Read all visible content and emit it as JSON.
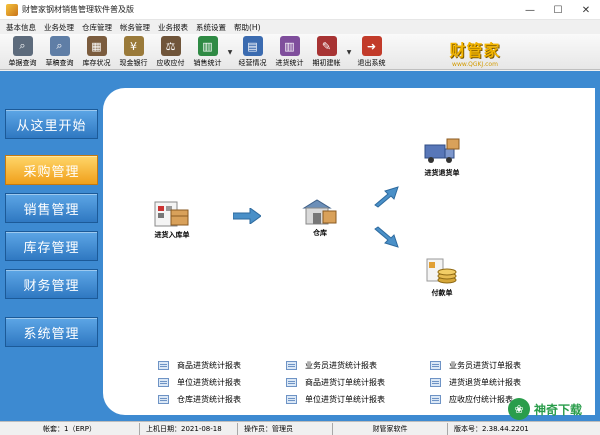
{
  "window": {
    "title": "财管家钢材销售管理软件普及版",
    "min": "—",
    "max": "☐",
    "close": "✕"
  },
  "menu": [
    "基本信息",
    "业务处理",
    "仓库管理",
    "帐务管理",
    "业务报表",
    "系统设置",
    "帮助(H)"
  ],
  "toolbar": [
    {
      "label": "单据查询",
      "icon": "search-doc-icon",
      "color": "#5d6b7c"
    },
    {
      "label": "草稿查询",
      "icon": "draft-search-icon",
      "color": "#5f7ea6"
    },
    {
      "label": "库存状况",
      "icon": "inventory-icon",
      "color": "#7b5c3e"
    },
    {
      "label": "现金银行",
      "icon": "cash-bank-icon",
      "color": "#9a7a3a"
    },
    {
      "label": "应收应付",
      "icon": "receivable-icon",
      "color": "#70553a"
    },
    {
      "label": "销售统计",
      "icon": "bar-chart-icon",
      "color": "#2f8a44"
    },
    {
      "label": "经营情况",
      "icon": "books-icon",
      "color": "#3b6bb0"
    },
    {
      "label": "进货统计",
      "icon": "purchase-stats-icon",
      "color": "#7f4e9c"
    },
    {
      "label": "期初建帐",
      "icon": "pen-icon",
      "color": "#a73333"
    },
    {
      "label": "退出系统",
      "icon": "exit-icon",
      "color": "#c23b2a"
    }
  ],
  "logo": {
    "text": "财管家",
    "sub": "www.QGKJ.com"
  },
  "nav": [
    "从这里开始",
    "采购管理",
    "销售管理",
    "库存管理",
    "财务管理",
    "系统管理"
  ],
  "nav_active": 1,
  "flow": {
    "purchase_in": "进货入库单",
    "warehouse": "仓库",
    "purchase_return": "进货退货单",
    "payment": "付款单"
  },
  "reports": [
    [
      "商品进货统计报表",
      "业务员进货统计报表",
      "业务员进货订单报表"
    ],
    [
      "单位进货统计报表",
      "商品进货订单统计报表",
      "进货退货单统计报表"
    ],
    [
      "仓库进货统计报表",
      "单位进货订单统计报表",
      "应收应付统计报表"
    ]
  ],
  "status": {
    "account": "帐套：1（ERP）",
    "date": "上机日期：2021-08-18",
    "operator": "操作员：管理员",
    "company": "财管家软件",
    "version": "版本号：2.38.44.2201"
  },
  "watermark": {
    "badge": "❀",
    "text": "神奇下载"
  }
}
